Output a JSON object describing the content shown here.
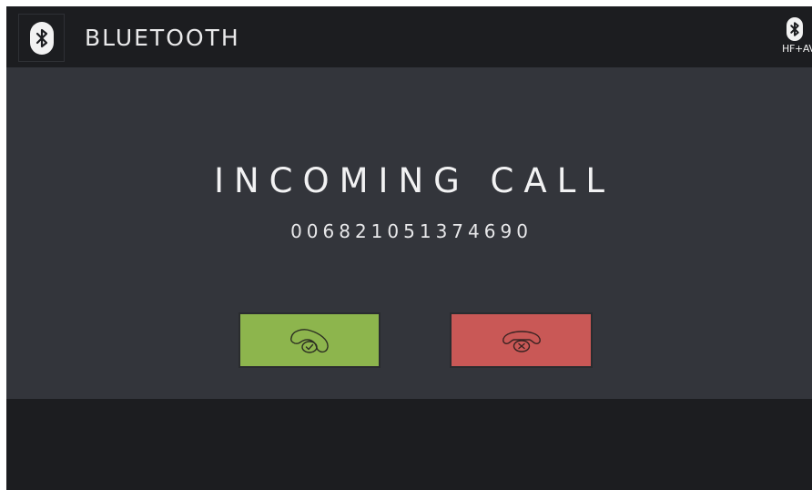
{
  "header": {
    "icon": "bluetooth-icon",
    "title": "BLUETOOTH",
    "status_icon": "bluetooth-icon",
    "status_label": "HF+AV"
  },
  "call": {
    "title": "INCOMING CALL",
    "number": "006821051374690",
    "accept_icon": "phone-accept-icon",
    "reject_icon": "phone-reject-icon"
  },
  "colors": {
    "accept": "#8db54d",
    "reject": "#c95856",
    "panel": "#33353b",
    "bar": "#1c1d20"
  }
}
